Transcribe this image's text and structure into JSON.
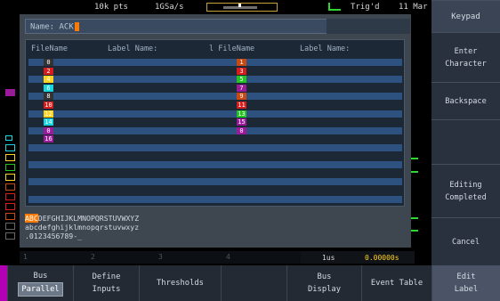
{
  "status": {
    "record_length": "10k pts",
    "sample_rate": "1GSa/s",
    "trigger_state": "Trig'd",
    "date": "11 Mar"
  },
  "dialog": {
    "name_label": "Name: ACK",
    "table_headers": {
      "col1_filename": "FileName",
      "col1_label": "Label Name:",
      "col2_filename": "l FileName",
      "col2_label": "Label Name:"
    },
    "left_labels": [
      {
        "text": "0",
        "color": "#333333"
      },
      {
        "text": "2",
        "color": "#d81c1c"
      },
      {
        "text": "4",
        "color": "#ffd21e"
      },
      {
        "text": "6",
        "color": "#17d6e0"
      },
      {
        "text": "8",
        "color": "#333333"
      },
      {
        "text": "10",
        "color": "#d81c1c"
      },
      {
        "text": "12",
        "color": "#ffd21e"
      },
      {
        "text": "14",
        "color": "#17d6e0"
      },
      {
        "text": "0",
        "color": "#9a1a9a"
      },
      {
        "text": "16",
        "color": "#9a1a9a"
      }
    ],
    "right_labels": [
      {
        "text": "1",
        "color": "#c84a12"
      },
      {
        "text": "3",
        "color": "#d81c1c"
      },
      {
        "text": "5",
        "color": "#22c322"
      },
      {
        "text": "7",
        "color": "#9a1a9a"
      },
      {
        "text": "9",
        "color": "#c84a12"
      },
      {
        "text": "11",
        "color": "#d81c1c"
      },
      {
        "text": "13",
        "color": "#22c322"
      },
      {
        "text": "15",
        "color": "#9a1a9a"
      },
      {
        "text": "0",
        "color": "#9a1a9a"
      }
    ],
    "charset_line1_highlight": "ABC",
    "charset_line1_rest": "DEFGHIJKLMNOPQRSTUVWXYZ",
    "charset_line2": "abcdefghijklmnopqrstuvwxyz",
    "charset_line3": ".0123456789-_"
  },
  "infobar": {
    "ch1": "1",
    "ch2": "2",
    "ch3": "3",
    "ch4": "4",
    "timebase": "1us",
    "offset": "0.00000s"
  },
  "right_menu": {
    "title": "Keypad",
    "enter_character": [
      "Enter",
      "Character"
    ],
    "backspace": "Backspace",
    "editing_completed": [
      "Editing",
      "Completed"
    ],
    "cancel": "Cancel"
  },
  "bottom_menu": {
    "bus_label": "Bus",
    "bus_value": "Parallel",
    "define_inputs": [
      "Define",
      "Inputs"
    ],
    "thresholds": "Thresholds",
    "bus_display": [
      "Bus",
      "Display"
    ],
    "event_table": "Event Table",
    "edit_label": [
      "Edit",
      "Label"
    ]
  },
  "colors": {
    "accent_orange": "#ff7a00",
    "trigger_green": "#2fd62f",
    "row_blue": "#2e5280"
  }
}
